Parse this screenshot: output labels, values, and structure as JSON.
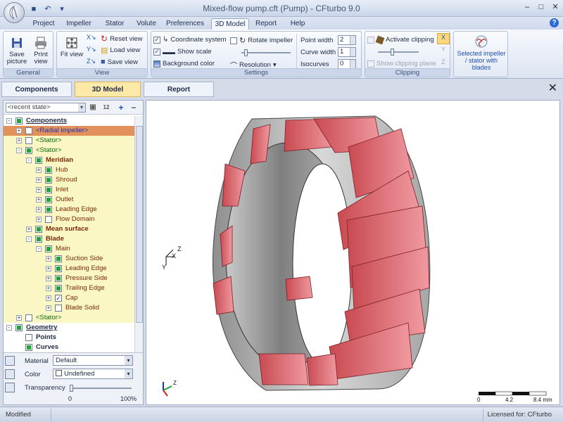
{
  "window": {
    "title": "Mixed-flow pump.cft (Pump) - CFturbo 9.0",
    "minimize": "–",
    "maximize": "□",
    "close": "✕"
  },
  "ribbon_tabs": [
    "Project",
    "Impeller",
    "Stator",
    "Volute",
    "Preferences",
    "3D Model",
    "Report",
    "Help"
  ],
  "active_ribbon_tab": "3D Model",
  "groups": {
    "general": {
      "label": "General",
      "save": "Save picture",
      "print": "Print view"
    },
    "view": {
      "label": "View",
      "fit": "Fit view",
      "reset": "Reset view",
      "load": "Load view",
      "save": "Save view"
    },
    "settings": {
      "label": "Settings",
      "coord": "Coordinate system",
      "scale": "Show scale",
      "bg": "Background color",
      "rotate": "Rotate impeller",
      "resolution": "Resolution",
      "point_width_label": "Point width",
      "point_width": "2",
      "curve_width_label": "Curve width",
      "curve_width": "1",
      "isocurves_label": "Isocurves",
      "isocurves": "0"
    },
    "clipping": {
      "label": "Clipping",
      "activate": "Activate clipping",
      "show_plane": "Show clipping plane"
    },
    "selected": {
      "label": "Selected impeller / stator with blades"
    }
  },
  "doc_tabs": [
    "Components",
    "3D Model",
    "Report"
  ],
  "active_doc_tab": "3D Model",
  "state": {
    "placeholder": "<recent state>",
    "counter": "12"
  },
  "tree": [
    {
      "label": "Components",
      "level": 0,
      "exp": "-",
      "box": "g",
      "style": "bold ul",
      "hl": false
    },
    {
      "label": "<Radial Impeller>",
      "level": 1,
      "exp": "+",
      "box": "empty",
      "style": "blue",
      "sel": true
    },
    {
      "label": "<Stator>",
      "level": 1,
      "exp": "+",
      "box": "empty",
      "style": "green",
      "hl": true
    },
    {
      "label": "<Stator>",
      "level": 1,
      "exp": "-",
      "box": "g",
      "style": "green",
      "hl": true
    },
    {
      "label": "Meridian",
      "level": 2,
      "exp": "-",
      "box": "g",
      "style": "bold brown",
      "hl": true
    },
    {
      "label": "Hub",
      "level": 3,
      "exp": "+",
      "box": "g",
      "style": "brown",
      "hl": true
    },
    {
      "label": "Shroud",
      "level": 3,
      "exp": "+",
      "box": "g",
      "style": "brown",
      "hl": true
    },
    {
      "label": "Inlet",
      "level": 3,
      "exp": "+",
      "box": "g",
      "style": "brown",
      "hl": true
    },
    {
      "label": "Outlet",
      "level": 3,
      "exp": "+",
      "box": "g",
      "style": "brown",
      "hl": true
    },
    {
      "label": "Leading Edge",
      "level": 3,
      "exp": "+",
      "box": "g",
      "style": "brown",
      "hl": true
    },
    {
      "label": "Flow Domain",
      "level": 3,
      "exp": "+",
      "box": "empty",
      "style": "brown",
      "hl": true
    },
    {
      "label": "Mean surface",
      "level": 2,
      "exp": "+",
      "box": "g",
      "style": "bold brown",
      "hl": true
    },
    {
      "label": "Blade",
      "level": 2,
      "exp": "-",
      "box": "g",
      "style": "bold brown",
      "hl": true
    },
    {
      "label": "Main",
      "level": 3,
      "exp": "-",
      "box": "g",
      "style": "brown",
      "hl": true
    },
    {
      "label": "Suction Side",
      "level": 4,
      "exp": "+",
      "box": "g",
      "style": "brown",
      "hl": true
    },
    {
      "label": "Leading Edge",
      "level": 4,
      "exp": "+",
      "box": "g",
      "style": "brown",
      "hl": true
    },
    {
      "label": "Pressure Side",
      "level": 4,
      "exp": "+",
      "box": "g",
      "style": "brown",
      "hl": true
    },
    {
      "label": "Trailing Edge",
      "level": 4,
      "exp": "+",
      "box": "g",
      "style": "brown",
      "hl": true
    },
    {
      "label": "Cap",
      "level": 4,
      "exp": "+",
      "box": "check",
      "style": "brown",
      "hl": true
    },
    {
      "label": "Blade Solid",
      "level": 4,
      "exp": "+",
      "box": "empty",
      "style": "brown",
      "hl": true
    },
    {
      "label": "<Stator>",
      "level": 1,
      "exp": "+",
      "box": "empty",
      "style": "green",
      "hl": true
    },
    {
      "label": "Geometry",
      "level": 0,
      "exp": "-",
      "box": "g",
      "style": "bold ul"
    },
    {
      "label": "Points",
      "level": 1,
      "exp": "",
      "box": "empty",
      "style": "bold"
    },
    {
      "label": "Curves",
      "level": 1,
      "exp": "",
      "box": "g",
      "style": "bold"
    }
  ],
  "props": {
    "material_label": "Material",
    "material": "Default",
    "color_label": "Color",
    "color": "Undefined",
    "transparency_label": "Transparency",
    "min": "0",
    "max": "100%"
  },
  "scale": {
    "v0": "0",
    "v1": "4.2",
    "v2": "8.4 mm"
  },
  "axes": {
    "x": "X",
    "y": "Y",
    "z": "Z"
  },
  "status": {
    "left": "Modified",
    "right": "Licensed for: CFturbo"
  }
}
